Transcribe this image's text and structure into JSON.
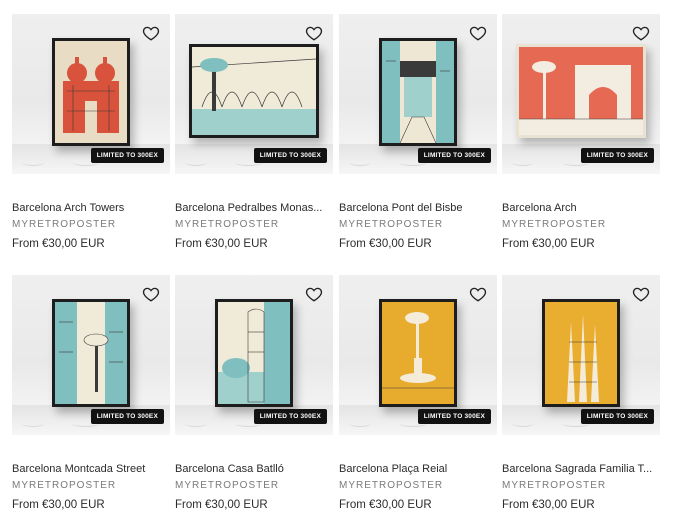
{
  "badge_label": "LIMITED TO 300EX",
  "products": [
    {
      "title": "Barcelona Arch Towers",
      "vendor": "MYRETROPOSTER",
      "price": "From €30,00 EUR",
      "poster_color": "#d9523b",
      "line_color": "#3a3a3a",
      "bg_color": "#e9dcc4",
      "heart_icon": "heart-outline-icon"
    },
    {
      "title": "Barcelona Pedralbes Monas...",
      "vendor": "MYRETROPOSTER",
      "price": "From €30,00 EUR",
      "poster_color": "#7fbfbf",
      "line_color": "#3a3a3a",
      "bg_color": "#f0ead9",
      "heart_icon": "heart-outline-icon"
    },
    {
      "title": "Barcelona Pont del Bisbe",
      "vendor": "MYRETROPOSTER",
      "price": "From €30,00 EUR",
      "poster_color": "#7fbfbf",
      "line_color": "#3a3a3a",
      "bg_color": "#eee7d4",
      "heart_icon": "heart-outline-icon"
    },
    {
      "title": "Barcelona Arch",
      "vendor": "MYRETROPOSTER",
      "price": "From €30,00 EUR",
      "poster_color": "#e66a53",
      "line_color": "#3a3a3a",
      "bg_color": "#f3ece0",
      "heart_icon": "heart-outline-icon"
    },
    {
      "title": "Barcelona Montcada Street",
      "vendor": "MYRETROPOSTER",
      "price": "From €30,00 EUR",
      "poster_color": "#7fbfbf",
      "line_color": "#3a3a3a",
      "bg_color": "#f0ead9",
      "heart_icon": "heart-outline-icon"
    },
    {
      "title": "Barcelona Casa Batlló",
      "vendor": "MYRETROPOSTER",
      "price": "From €30,00 EUR",
      "poster_color": "#7fbfbf",
      "line_color": "#3a3a3a",
      "bg_color": "#f0ead9",
      "heart_icon": "heart-outline-icon"
    },
    {
      "title": "Barcelona Plaça Reial",
      "vendor": "MYRETROPOSTER",
      "price": "From €30,00 EUR",
      "poster_color": "#e7ab2e",
      "line_color": "#3a3a3a",
      "bg_color": "#e7ab2e",
      "heart_icon": "heart-outline-icon"
    },
    {
      "title": "Barcelona Sagrada Familia T...",
      "vendor": "MYRETROPOSTER",
      "price": "From €30,00 EUR",
      "poster_color": "#e9ad2f",
      "line_color": "#3a3a3a",
      "bg_color": "#e9ad2f",
      "heart_icon": "heart-outline-icon"
    }
  ]
}
